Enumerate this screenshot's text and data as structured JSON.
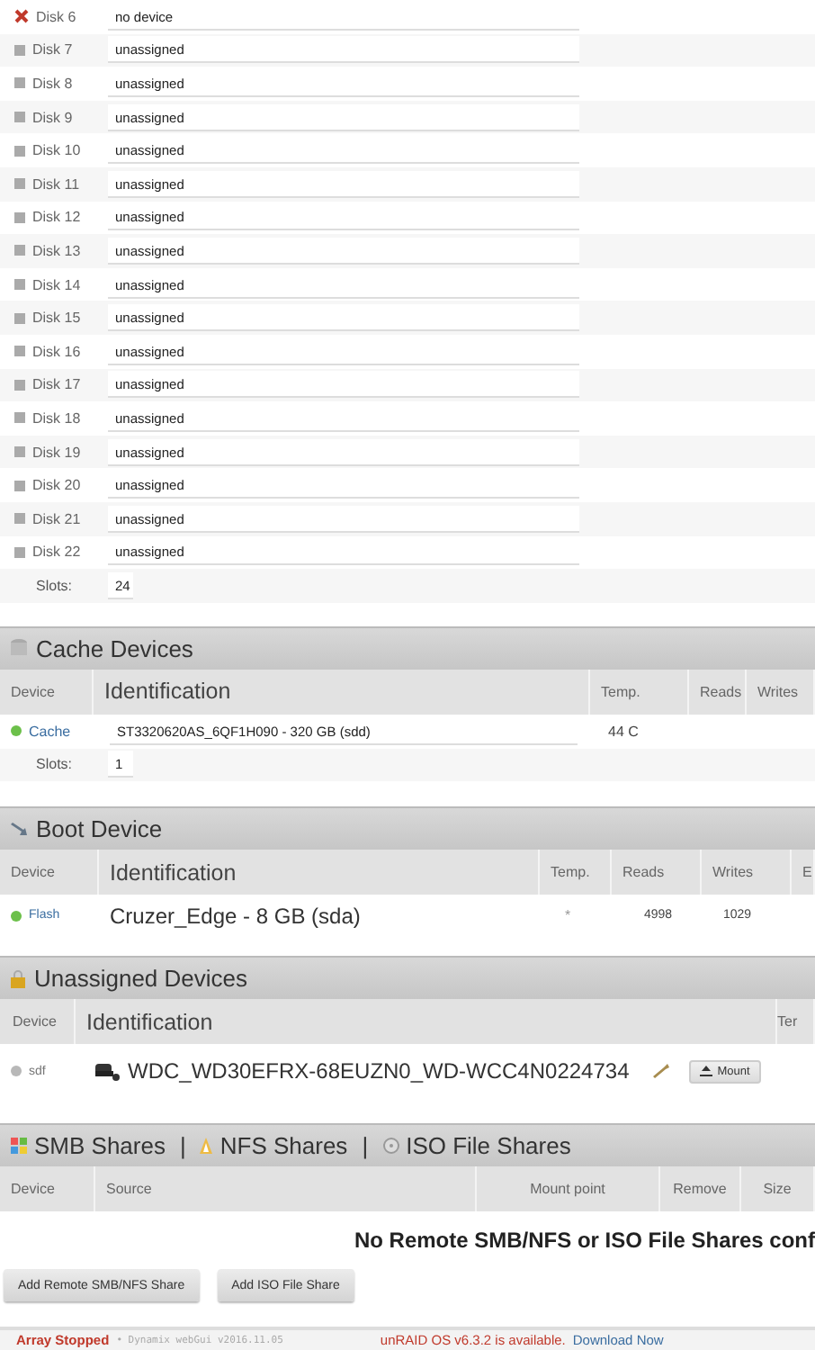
{
  "array_disks": [
    {
      "name": "Disk 6",
      "kind": "missing",
      "value": "no device"
    },
    {
      "name": "Disk 7",
      "kind": "unassigned",
      "value": "unassigned"
    },
    {
      "name": "Disk 8",
      "kind": "unassigned",
      "value": "unassigned"
    },
    {
      "name": "Disk 9",
      "kind": "unassigned",
      "value": "unassigned"
    },
    {
      "name": "Disk 10",
      "kind": "unassigned",
      "value": "unassigned"
    },
    {
      "name": "Disk 11",
      "kind": "unassigned",
      "value": "unassigned"
    },
    {
      "name": "Disk 12",
      "kind": "unassigned",
      "value": "unassigned"
    },
    {
      "name": "Disk 13",
      "kind": "unassigned",
      "value": "unassigned"
    },
    {
      "name": "Disk 14",
      "kind": "unassigned",
      "value": "unassigned"
    },
    {
      "name": "Disk 15",
      "kind": "unassigned",
      "value": "unassigned"
    },
    {
      "name": "Disk 16",
      "kind": "unassigned",
      "value": "unassigned"
    },
    {
      "name": "Disk 17",
      "kind": "unassigned",
      "value": "unassigned"
    },
    {
      "name": "Disk 18",
      "kind": "unassigned",
      "value": "unassigned"
    },
    {
      "name": "Disk 19",
      "kind": "unassigned",
      "value": "unassigned"
    },
    {
      "name": "Disk 20",
      "kind": "unassigned",
      "value": "unassigned"
    },
    {
      "name": "Disk 21",
      "kind": "unassigned",
      "value": "unassigned"
    },
    {
      "name": "Disk 22",
      "kind": "unassigned",
      "value": "unassigned"
    }
  ],
  "array_slots": {
    "label": "Slots:",
    "value": "24"
  },
  "cache": {
    "title": "Cache Devices",
    "columns": [
      "Device",
      "Identification",
      "Temp.",
      "Reads",
      "Writes"
    ],
    "rows": [
      {
        "device": "Cache",
        "color": "#6cc04a",
        "identification": "ST3320620AS_6QF1H090 - 320 GB (sdd)",
        "temp": "44 C",
        "reads": "",
        "writes": ""
      }
    ],
    "slots": {
      "label": "Slots:",
      "value": "1"
    }
  },
  "boot": {
    "title": "Boot Device",
    "columns": [
      "Device",
      "Identification",
      "Temp.",
      "Reads",
      "Writes",
      "E"
    ],
    "rows": [
      {
        "device": "Flash",
        "color": "#6cc04a",
        "identification": "Cruzer_Edge - 8 GB (sda)",
        "temp": "*",
        "reads": "4998",
        "writes": "1029"
      }
    ]
  },
  "unassigned": {
    "title": "Unassigned Devices",
    "columns": [
      "Device",
      "Identification",
      "Ter"
    ],
    "rows": [
      {
        "device": "sdf",
        "color": "#b8b8b8",
        "identification": "WDC_WD30EFRX-68EUZN0_WD-WCC4N0224734",
        "button": "Mount"
      }
    ]
  },
  "shares": {
    "tabs": [
      "SMB Shares",
      "NFS Shares",
      "ISO File Shares"
    ],
    "separator": "|",
    "columns": [
      "Device",
      "Source",
      "Mount point",
      "Remove",
      "Size"
    ],
    "message": "No Remote SMB/NFS or ISO File Shares conf",
    "buttons": [
      "Add Remote SMB/NFS Share",
      "Add ISO File Share"
    ]
  },
  "footer": {
    "status": "Array Stopped",
    "version": "• Dynamix webGui v2016.11.05",
    "notice": "unRAID OS v6.3.2 is available.",
    "link": "Download Now"
  }
}
